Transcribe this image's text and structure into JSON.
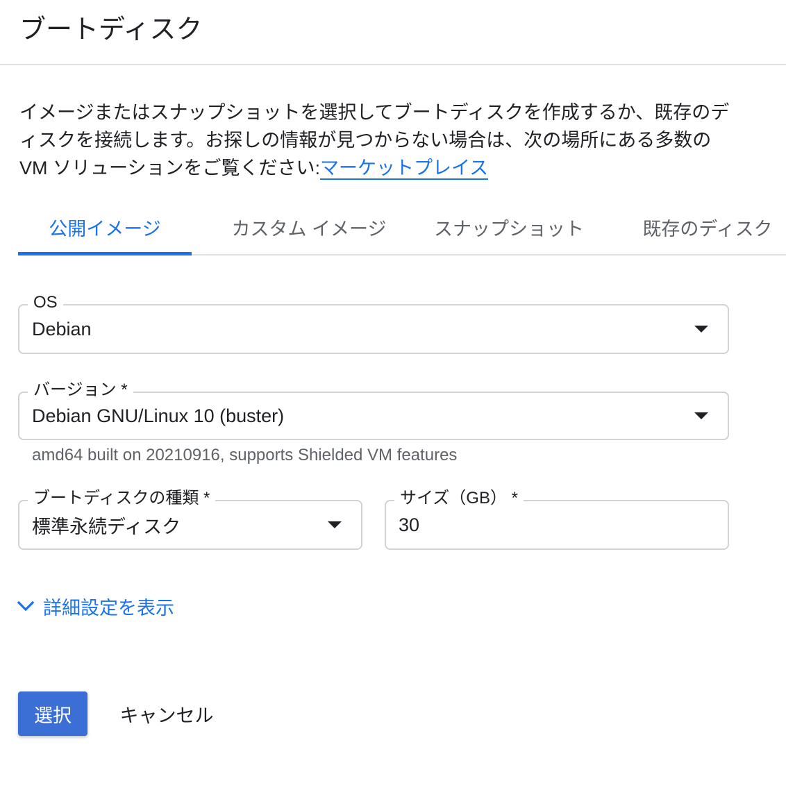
{
  "header": {
    "title": "ブートディスク"
  },
  "description": {
    "text": "イメージまたはスナップショットを選択してブートディスクを作成するか、既存のディスクを接続します。お探しの情報が見つからない場合は、次の場所にある多数の VM ソリューションをご覧ください:",
    "link_label": "マーケットプレイス"
  },
  "tabs": [
    {
      "label": "公開イメージ",
      "active": true
    },
    {
      "label": "カスタム イメージ",
      "active": false
    },
    {
      "label": "スナップショット",
      "active": false
    },
    {
      "label": "既存のディスク",
      "active": false
    }
  ],
  "os_field": {
    "label": "OS",
    "value": "Debian"
  },
  "version_field": {
    "label": "バージョン *",
    "value": "Debian GNU/Linux 10 (buster)",
    "hint": "amd64 built on 20210916, supports Shielded VM features"
  },
  "disk_type_field": {
    "label": "ブートディスクの種類 *",
    "value": "標準永続ディスク"
  },
  "size_field": {
    "label": "サイズ（GB） *",
    "value": "30"
  },
  "advanced": {
    "label": "詳細設定を表示",
    "icon": "chevron-down-icon"
  },
  "actions": {
    "select_label": "選択",
    "cancel_label": "キャンセル"
  },
  "colors": {
    "accent": "#1a73e8",
    "primary_button": "#3b6fd6",
    "border": "#cfd2d6",
    "text": "#202124",
    "secondary_text": "#5f6368"
  }
}
